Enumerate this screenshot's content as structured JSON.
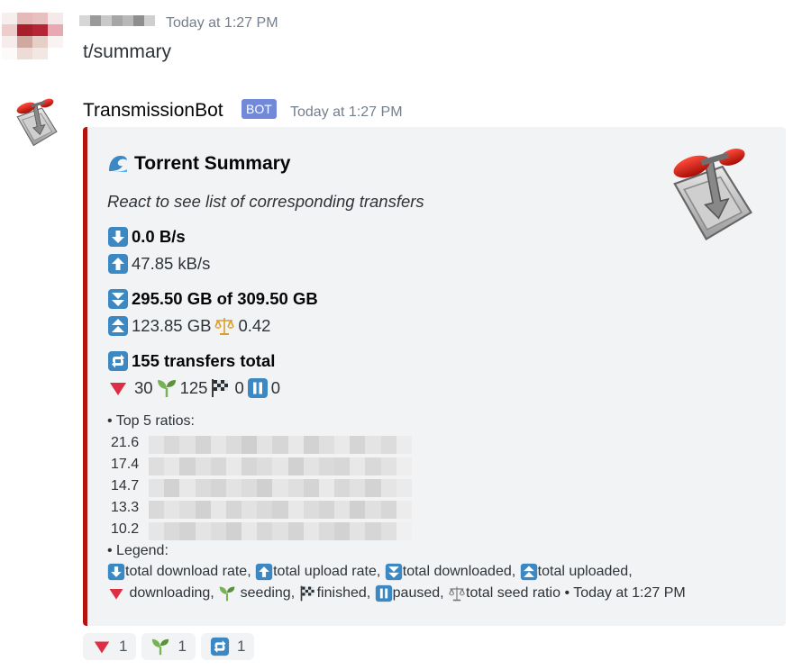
{
  "message_user": {
    "timestamp": "Today at 1:27 PM",
    "text": "t/summary"
  },
  "bot_message": {
    "name": "TransmissionBot",
    "tag": "BOT",
    "timestamp": "Today at 1:27 PM",
    "embed": {
      "accent_color": "#b3140e",
      "title": "Torrent Summary",
      "description": "React to see list of corresponding transfers",
      "download_rate": "0.0 B/s",
      "upload_rate": "47.85 kB/s",
      "downloaded": "295.50 GB of 309.50 GB",
      "uploaded": "123.85 GB",
      "ratio": "0.42",
      "transfers_total": "155 transfers total",
      "counts": {
        "downloading": "30",
        "seeding": "125",
        "finished": "0",
        "paused": "0"
      },
      "top_ratios_label": "• Top 5 ratios:",
      "top_ratios": [
        "21.6",
        "17.4",
        "14.7",
        "13.3",
        "10.2"
      ],
      "legend_label": "• Legend:",
      "legend": {
        "download_rate": "total download rate,",
        "upload_rate": "total upload rate,",
        "downloaded": "total downloaded,",
        "uploaded": "total uploaded,",
        "downloading": "downloading,",
        "seeding": "seeding,",
        "finished": "finished,",
        "paused": "paused,",
        "seed_ratio": "total seed ratio",
        "footer_timestamp": "• Today at 1:27 PM"
      }
    }
  },
  "reactions": [
    {
      "icon": "red-triangle-down-icon",
      "count": "1"
    },
    {
      "icon": "seedling-icon",
      "count": "1"
    },
    {
      "icon": "repeat-arrows-icon",
      "count": "1"
    }
  ]
}
